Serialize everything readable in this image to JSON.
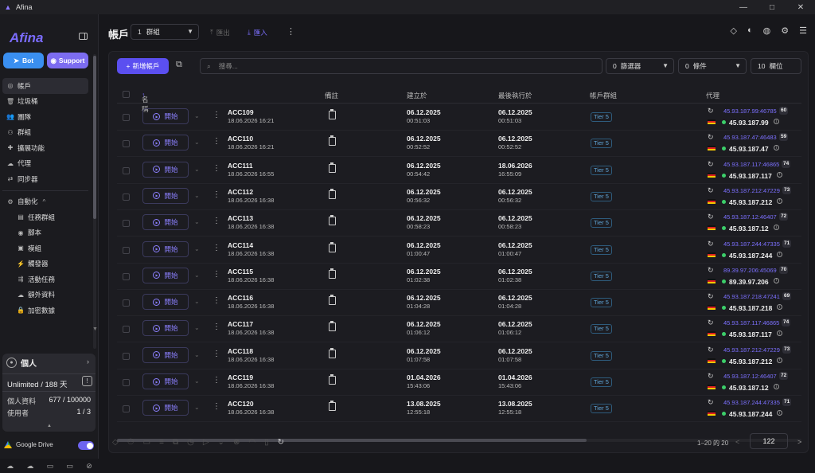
{
  "window": {
    "title": "Afina",
    "minimize": "—",
    "maximize": "□",
    "close": "✕"
  },
  "sidebar": {
    "brand": "Afina",
    "bot_label": "Bot",
    "support_label": "Support",
    "items": [
      {
        "label": "帳戶",
        "icon": "user-circle-icon",
        "glyph": "◎"
      },
      {
        "label": "垃圾桶",
        "icon": "trash-icon",
        "glyph": "🗑"
      },
      {
        "label": "團隊",
        "icon": "team-icon",
        "glyph": "👥"
      },
      {
        "label": "群組",
        "icon": "group-icon",
        "glyph": "⚇"
      },
      {
        "label": "擴展功能",
        "icon": "puzzle-icon",
        "glyph": "✚"
      },
      {
        "label": "代理",
        "icon": "cloud-icon",
        "glyph": "☁"
      },
      {
        "label": "同步器",
        "icon": "sync-icon",
        "glyph": "⇄"
      }
    ],
    "automation": {
      "label": "自動化",
      "chevron": "^"
    },
    "sub_items": [
      {
        "label": "任務群組",
        "glyph": "▤"
      },
      {
        "label": "腳本",
        "glyph": "◉"
      },
      {
        "label": "模組",
        "glyph": "▣"
      },
      {
        "label": "觸發器",
        "glyph": "⚡"
      },
      {
        "label": "活動任務",
        "glyph": "⇶"
      },
      {
        "label": "額外資料",
        "glyph": "☁"
      },
      {
        "label": "加密數據",
        "glyph": "🔒"
      }
    ],
    "profile": {
      "title": "個人",
      "plan": "Unlimited / 188 天",
      "profiles_label": "個人資料",
      "profiles_value": "677 / 100000",
      "users_label": "使用者",
      "users_value": "1 / 3"
    },
    "gdrive_label": "Google Drive"
  },
  "topbar": {
    "title": "帳戶",
    "group_count": "1",
    "group_label": "群組",
    "export_label": "匯出",
    "import_label": "匯入"
  },
  "toolbar": {
    "new_account": "新增帳戶",
    "search_placeholder": "搜尋...",
    "filter_count": "0",
    "filter_label": "篩選器",
    "condition_count": "0",
    "condition_label": "條件",
    "columns_count": "10",
    "columns_label": "欄位"
  },
  "table": {
    "headers": {
      "name": "名稱",
      "sort": "↑",
      "note": "備註",
      "created": "建立於",
      "last_run": "最後執行於",
      "group": "帳戶群組",
      "proxy": "代理"
    },
    "start_label": "開始",
    "rows": [
      {
        "name": "ACC109",
        "name_date": "18.06.2026 16:21",
        "created_d": "06.12.2025",
        "created_t": "00:51:03",
        "last_d": "06.12.2025",
        "last_t": "00:51:03",
        "tier": "Tier 5",
        "proxy": "45.93.187.99:46785",
        "ping": "60",
        "ip": "45.93.187.99"
      },
      {
        "name": "ACC110",
        "name_date": "18.06.2026 16:21",
        "created_d": "06.12.2025",
        "created_t": "00:52:52",
        "last_d": "06.12.2025",
        "last_t": "00:52:52",
        "tier": "Tier 5",
        "proxy": "45.93.187.47:46483",
        "ping": "59",
        "ip": "45.93.187.47"
      },
      {
        "name": "ACC111",
        "name_date": "18.06.2026 16:55",
        "created_d": "06.12.2025",
        "created_t": "00:54:42",
        "last_d": "18.06.2026",
        "last_t": "16:55:09",
        "tier": "Tier 5",
        "proxy": "45.93.187.117:46865",
        "ping": "74",
        "ip": "45.93.187.117"
      },
      {
        "name": "ACC112",
        "name_date": "18.06.2026 16:38",
        "created_d": "06.12.2025",
        "created_t": "00:56:32",
        "last_d": "06.12.2025",
        "last_t": "00:56:32",
        "tier": "Tier 5",
        "proxy": "45.93.187.212:47229",
        "ping": "73",
        "ip": "45.93.187.212"
      },
      {
        "name": "ACC113",
        "name_date": "18.06.2026 16:38",
        "created_d": "06.12.2025",
        "created_t": "00:58:23",
        "last_d": "06.12.2025",
        "last_t": "00:58:23",
        "tier": "Tier 5",
        "proxy": "45.93.187.12:46407",
        "ping": "72",
        "ip": "45.93.187.12"
      },
      {
        "name": "ACC114",
        "name_date": "18.06.2026 16:38",
        "created_d": "06.12.2025",
        "created_t": "01:00:47",
        "last_d": "06.12.2025",
        "last_t": "01:00:47",
        "tier": "Tier 5",
        "proxy": "45.93.187.244:47335",
        "ping": "71",
        "ip": "45.93.187.244"
      },
      {
        "name": "ACC115",
        "name_date": "18.06.2026 16:38",
        "created_d": "06.12.2025",
        "created_t": "01:02:38",
        "last_d": "06.12.2025",
        "last_t": "01:02:38",
        "tier": "Tier 5",
        "proxy": "89.39.97.206:45069",
        "ping": "70",
        "ip": "89.39.97.206"
      },
      {
        "name": "ACC116",
        "name_date": "18.06.2026 16:38",
        "created_d": "06.12.2025",
        "created_t": "01:04:28",
        "last_d": "06.12.2025",
        "last_t": "01:04:28",
        "tier": "Tier 5",
        "proxy": "45.93.187.218:47241",
        "ping": "69",
        "ip": "45.93.187.218"
      },
      {
        "name": "ACC117",
        "name_date": "18.06.2026 16:38",
        "created_d": "06.12.2025",
        "created_t": "01:06:12",
        "last_d": "06.12.2025",
        "last_t": "01:06:12",
        "tier": "Tier 5",
        "proxy": "45.93.187.117:46865",
        "ping": "74",
        "ip": "45.93.187.117"
      },
      {
        "name": "ACC118",
        "name_date": "18.06.2026 16:38",
        "created_d": "06.12.2025",
        "created_t": "01:07:58",
        "last_d": "06.12.2025",
        "last_t": "01:07:58",
        "tier": "Tier 5",
        "proxy": "45.93.187.212:47229",
        "ping": "73",
        "ip": "45.93.187.212"
      },
      {
        "name": "ACC119",
        "name_date": "18.06.2026 16:38",
        "created_d": "01.04.2026",
        "created_t": "15:43:06",
        "last_d": "01.04.2026",
        "last_t": "15:43:06",
        "tier": "Tier 5",
        "proxy": "45.93.187.12:46407",
        "ping": "72",
        "ip": "45.93.187.12"
      },
      {
        "name": "ACC120",
        "name_date": "18.06.2026 16:38",
        "created_d": "13.08.2025",
        "created_t": "12:55:18",
        "last_d": "13.08.2025",
        "last_t": "12:55:18",
        "tier": "Tier 5",
        "proxy": "45.93.187.244:47335",
        "ping": "71",
        "ip": "45.93.187.244"
      }
    ]
  },
  "pagination": {
    "info": "1–20 的 20",
    "page": "122",
    "prev": "<",
    "next": ">"
  },
  "colors": {
    "accent": "#5b4ff0",
    "link": "#7c70ff",
    "tier": "#5fa4d6",
    "online": "#3ccf6a",
    "bot": "#3a8ff0",
    "support": "#7c6cf0"
  }
}
